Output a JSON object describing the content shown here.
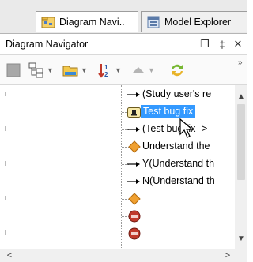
{
  "tabs": [
    {
      "label": "Diagram Navi..",
      "icon": "diagram-navigator-icon",
      "active": true
    },
    {
      "label": "Model Explorer",
      "icon": "model-explorer-icon",
      "active": false
    }
  ],
  "panel": {
    "title": "Diagram Navigator",
    "restore_glyph": "❐",
    "pin_glyph": "‡",
    "close_glyph": "✕"
  },
  "toolbar": {
    "overflow_glyph": "»",
    "items": [
      "square-icon",
      "hierarchy-icon",
      "folder-icon",
      "sort-icon",
      "up-icon",
      "sync-icon"
    ]
  },
  "tree": {
    "rows": [
      {
        "icon": "arrow-icon",
        "label": "(Study user's re"
      },
      {
        "icon": "test-bug-fix-icon",
        "label": "Test bug fix",
        "selected": true
      },
      {
        "icon": "arrow-icon",
        "label": "(Test bug fix ->"
      },
      {
        "icon": "diamond-icon",
        "label": "Understand the"
      },
      {
        "icon": "arrow-icon",
        "label": "Y(Understand th"
      },
      {
        "icon": "arrow-icon",
        "label": "N(Understand th"
      },
      {
        "icon": "diamond-icon",
        "label": ""
      },
      {
        "icon": "red-circle-icon",
        "label": ""
      },
      {
        "icon": "red-circle-icon",
        "label": ""
      }
    ]
  },
  "colors": {
    "selection": "#3399ff",
    "diamond": "#f0a030",
    "stop": "#c0392b"
  }
}
